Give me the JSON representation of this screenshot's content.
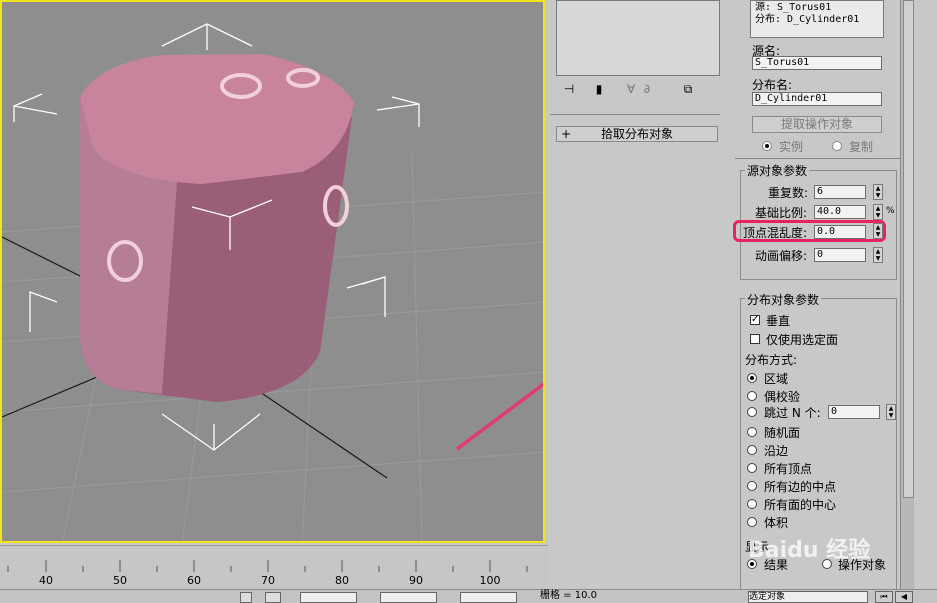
{
  "ruler": {
    "ticks": [
      "40",
      "50",
      "60",
      "70",
      "80",
      "90",
      "100"
    ]
  },
  "status": {
    "snap_label": "栅格 = 10.0",
    "select_object": "选定对象"
  },
  "mid_panel": {
    "pick_button": "拾取分布对象",
    "plus": "+"
  },
  "right_panel": {
    "list_lines": [
      "源: S_Torus01",
      "分布: D_Cylinder01"
    ],
    "source_name_label": "源名:",
    "source_name_value": "S_Torus01",
    "dist_name_label": "分布名:",
    "dist_name_value": "D_Cylinder01",
    "extract_button": "提取操作对象",
    "radio_instance": "实例",
    "radio_copy": "复制",
    "source_params": {
      "title": "源对象参数",
      "duplicates_label": "重复数:",
      "duplicates_value": "6",
      "base_scale_label": "基础比例:",
      "base_scale_value": "40.0",
      "base_scale_unit": "%",
      "vertex_chaos_label": "顶点混乱度:",
      "vertex_chaos_value": "0.0",
      "anim_offset_label": "动画偏移:",
      "anim_offset_value": "0"
    },
    "dist_params": {
      "title": "分布对象参数",
      "perpendicular": "垂直",
      "use_selected_faces": "仅使用选定面",
      "distribute_by": "分布方式:",
      "options": [
        "区域",
        "偶校验",
        "跳过 N 个:",
        "随机面",
        "沿边",
        "所有顶点",
        "所有边的中点",
        "所有面的中心",
        "体积"
      ],
      "skip_n_value": "0",
      "display_label": "显示",
      "result": "结果",
      "operand": "操作对象"
    }
  },
  "watermark": "Baidu 经验",
  "colors": {
    "viewport_border": "#f0e41c",
    "highlight": "#e8245f",
    "arrow": "#e03a6e",
    "cylinder": "#b87a92"
  }
}
